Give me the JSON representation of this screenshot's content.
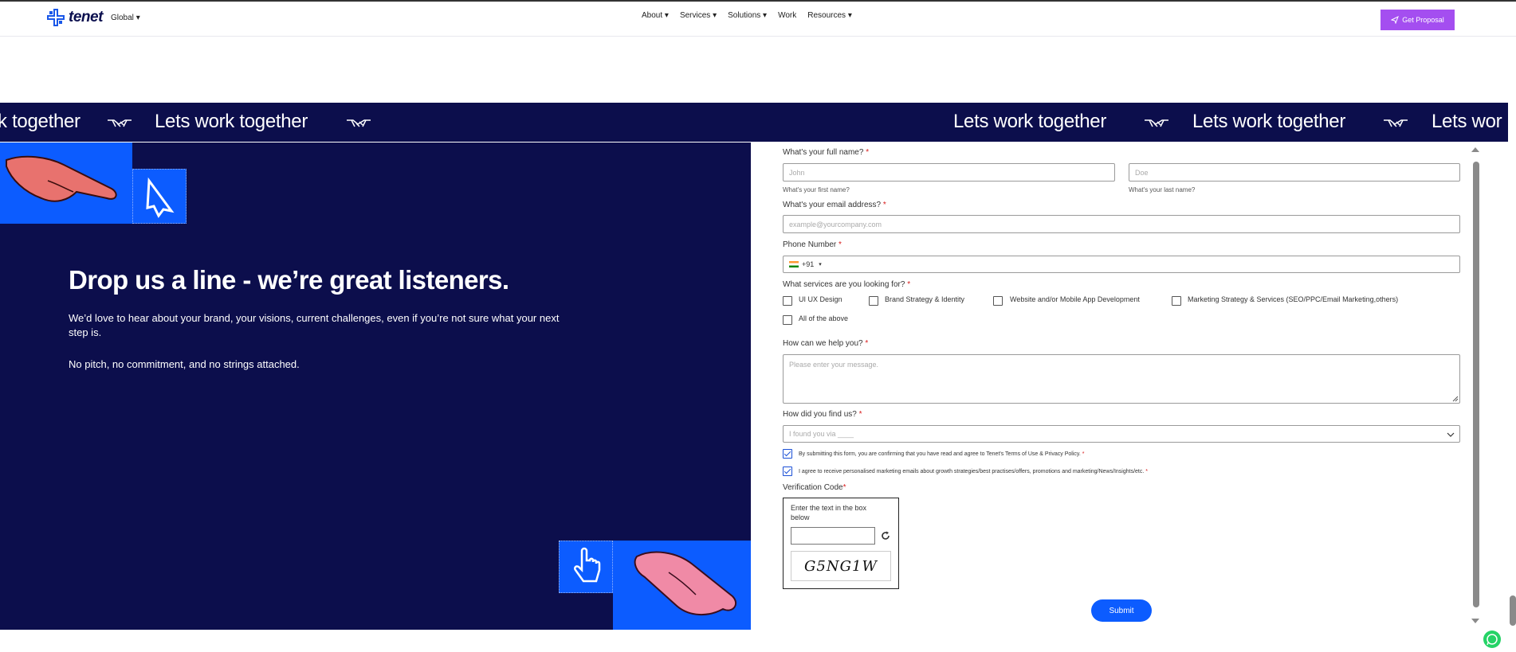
{
  "header": {
    "logo_text": "tenet",
    "region": "Global",
    "nav": [
      "About",
      "Services",
      "Solutions",
      "Work",
      "Resources"
    ],
    "cta": "Get Proposal"
  },
  "marquee": {
    "items": [
      "k together",
      "Lets work together",
      "Lets work together",
      "Lets work together",
      "Lets wor"
    ]
  },
  "hero": {
    "headline": "Drop us a line - we’re great listeners.",
    "paragraph1": "We’d love to hear about your brand, your visions, current challenges, even if you’re not sure what your next step is.",
    "paragraph2": "No pitch, no commitment, and no strings attached."
  },
  "form": {
    "name_label": "What's your full name?",
    "first_placeholder": "John",
    "last_placeholder": "Doe",
    "first_hint": "What's your first name?",
    "last_hint": "What's your last name?",
    "email_label": "What's your email address?",
    "email_placeholder": "example@yourcompany.com",
    "phone_label": "Phone Number",
    "phone_code": "+91",
    "services_label": "What services are you looking for?",
    "services": [
      "UI UX Design",
      "Brand Strategy & Identity",
      "Website and/or Mobile App Development",
      "Marketing Strategy & Services (SEO/PPC/Email Marketing,others)",
      "All of the above"
    ],
    "help_label": "How can we help you?",
    "help_placeholder": "Please enter your message.",
    "find_label": "How did you find us?",
    "find_placeholder": "I found you via ____",
    "consent1": "By submitting this form, you are confirming that you have read and agree to Tenet's Terms of Use & Privacy Policy.",
    "consent2": "I agree to receive personalised marketing emails about growth strategies/best practises/offers, promotions and marketing/News/Insights/etc.",
    "verification_label": "Verification Code",
    "captcha_instruction": "Enter the text in the box below",
    "captcha_text": "G5NG1W",
    "submit": "Submit",
    "required_mark": "*"
  },
  "colors": {
    "navy": "#0c0e4c",
    "blue": "#0c5cff",
    "purple": "#a44ef0"
  }
}
